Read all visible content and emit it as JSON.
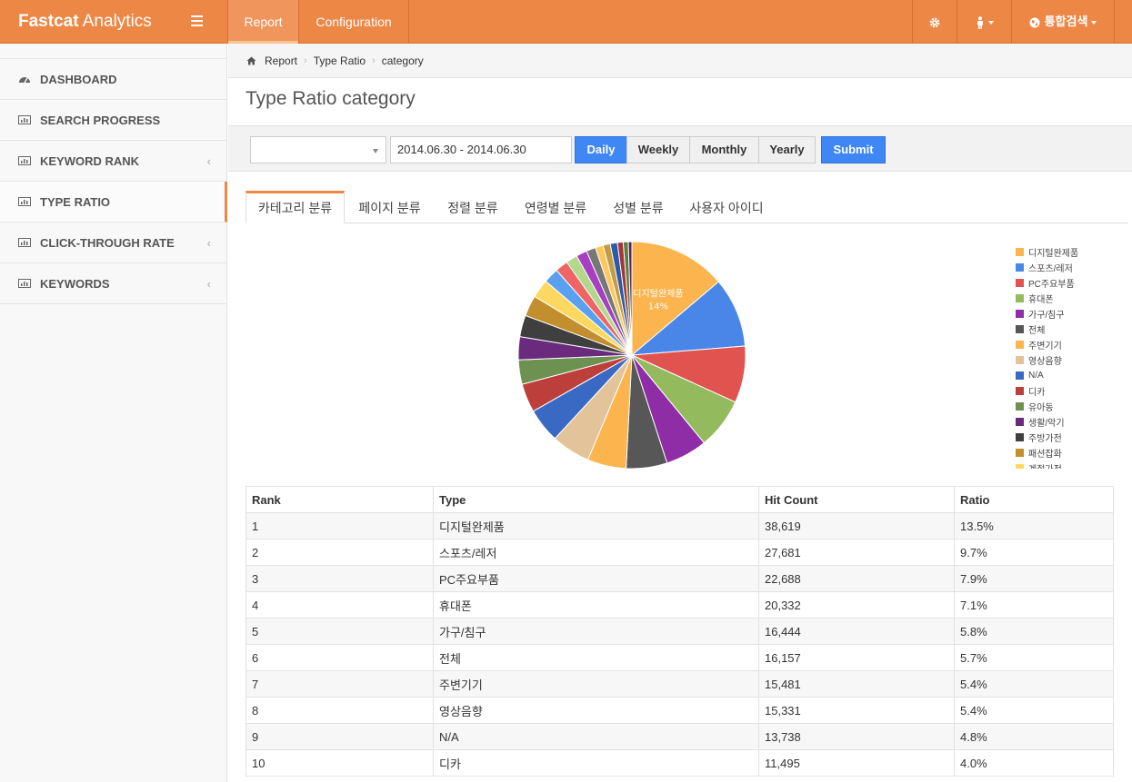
{
  "app": {
    "brand_bold": "Fastcat",
    "brand_rest": " Analytics"
  },
  "topnav": {
    "items": [
      "Report",
      "Configuration"
    ],
    "right": {
      "search_label": "통합검색"
    }
  },
  "sidebar": {
    "items": [
      {
        "label": "DASHBOARD",
        "chevron": ""
      },
      {
        "label": "SEARCH PROGRESS",
        "chevron": ""
      },
      {
        "label": "KEYWORD RANK",
        "chevron": "‹"
      },
      {
        "label": "TYPE RATIO",
        "chevron": ""
      },
      {
        "label": "CLICK-THROUGH RATE",
        "chevron": "‹"
      },
      {
        "label": "KEYWORDS",
        "chevron": "‹"
      }
    ]
  },
  "breadcrumb": [
    "Report",
    "Type Ratio",
    "category"
  ],
  "page": {
    "title": "Type Ratio category"
  },
  "filter": {
    "date_range": "2014.06.30 - 2014.06.30",
    "buttons": [
      "Daily",
      "Weekly",
      "Monthly",
      "Yearly"
    ],
    "submit": "Submit"
  },
  "tabs": [
    "카테고리 분류",
    "페이지 분류",
    "정렬 분류",
    "연령별 분류",
    "성별 분류",
    "사용자 아이디"
  ],
  "chart_data": {
    "type": "pie",
    "slice_label": "디지털완제품",
    "slice_pct": "14%",
    "slices": [
      {
        "name": "디지털완제품",
        "value": 13.5,
        "color": "#fbb44e"
      },
      {
        "name": "스포츠/레저",
        "value": 9.7,
        "color": "#4a86e8"
      },
      {
        "name": "PC주요부품",
        "value": 7.9,
        "color": "#e0534f"
      },
      {
        "name": "휴대폰",
        "value": 7.1,
        "color": "#93bb5e"
      },
      {
        "name": "가구/침구",
        "value": 5.8,
        "color": "#8e2da5"
      },
      {
        "name": "전체",
        "value": 5.7,
        "color": "#575757"
      },
      {
        "name": "주변기기",
        "value": 5.4,
        "color": "#fbb44e"
      },
      {
        "name": "영상음향",
        "value": 5.4,
        "color": "#e3c39a"
      },
      {
        "name": "N/A",
        "value": 4.8,
        "color": "#3a69c4"
      },
      {
        "name": "디카",
        "value": 4.0,
        "color": "#bd3f3b"
      },
      {
        "name": "유아동",
        "value": 3.4,
        "color": "#6d9150"
      },
      {
        "name": "생활/악기",
        "value": 3.2,
        "color": "#6a2a7d"
      },
      {
        "name": "주방가전",
        "value": 3.0,
        "color": "#3f3f3f"
      },
      {
        "name": "패션잡화",
        "value": 2.9,
        "color": "#c28e2e"
      },
      {
        "name": "계절가전",
        "value": 2.6,
        "color": "#fdd860"
      },
      {
        "name": "",
        "value": 2.1,
        "color": "#5aa0f0"
      },
      {
        "name": "",
        "value": 1.8,
        "color": "#ef6464"
      },
      {
        "name": "",
        "value": 1.6,
        "color": "#b3d88c"
      },
      {
        "name": "",
        "value": 1.5,
        "color": "#a63fc0"
      },
      {
        "name": "",
        "value": 1.3,
        "color": "#777777"
      },
      {
        "name": "",
        "value": 1.1,
        "color": "#fcc85e"
      },
      {
        "name": "",
        "value": 1.0,
        "color": "#c59a44"
      },
      {
        "name": "",
        "value": 1.0,
        "color": "#2b5aa8"
      },
      {
        "name": "",
        "value": 0.8,
        "color": "#a53535"
      },
      {
        "name": "",
        "value": 0.7,
        "color": "#5b7d42"
      },
      {
        "name": "",
        "value": 0.5,
        "color": "#55225f"
      }
    ],
    "legend_position": "right"
  },
  "table": {
    "headers": [
      "Rank",
      "Type",
      "Hit Count",
      "Ratio"
    ],
    "rows": [
      [
        "1",
        "디지털완제품",
        "38,619",
        "13.5%"
      ],
      [
        "2",
        "스포츠/레저",
        "27,681",
        "9.7%"
      ],
      [
        "3",
        "PC주요부품",
        "22,688",
        "7.9%"
      ],
      [
        "4",
        "휴대폰",
        "20,332",
        "7.1%"
      ],
      [
        "5",
        "가구/침구",
        "16,444",
        "5.8%"
      ],
      [
        "6",
        "전체",
        "16,157",
        "5.7%"
      ],
      [
        "7",
        "주변기기",
        "15,481",
        "5.4%"
      ],
      [
        "8",
        "영상음향",
        "15,331",
        "5.4%"
      ],
      [
        "9",
        "N/A",
        "13,738",
        "4.8%"
      ],
      [
        "10",
        "디카",
        "11,495",
        "4.0%"
      ]
    ]
  },
  "colors": {
    "accent": "#ed8746",
    "primary_button": "#3f87f5"
  }
}
